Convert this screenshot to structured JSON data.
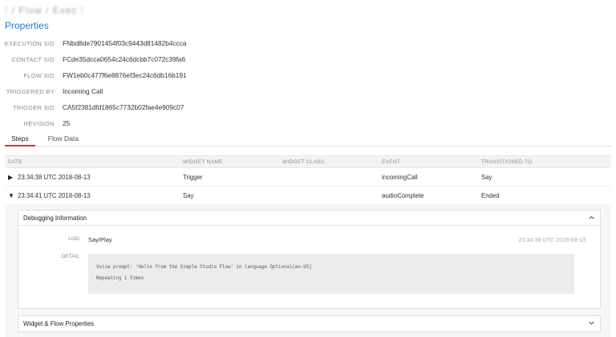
{
  "breadcrumb": {
    "text": "⁞ / Flow / Exec ⁞"
  },
  "page_title": "Properties",
  "properties": [
    {
      "label": "EXECUTION SID",
      "value": "FNbd8de7901454f03c9443d81482b4ccca"
    },
    {
      "label": "CONTACT SID",
      "value": "FCde35dcca0654c24c6dcbb7c072c39fa6"
    },
    {
      "label": "FLOW SID",
      "value": "FW1eb0c477f6e8876ef3ec24c6db16b191"
    },
    {
      "label": "TRIGGERED BY",
      "value": "Incoming Call"
    },
    {
      "label": "TRIGGER SID",
      "value": "CA5f2381dfd1865c7732b02fae4e909c07"
    },
    {
      "label": "REVISION",
      "value": "25"
    }
  ],
  "tabs": [
    {
      "label": "Steps",
      "active": true
    },
    {
      "label": "Flow Data",
      "active": false
    }
  ],
  "table": {
    "headers": [
      "DATE",
      "WIDGET NAME",
      "WIDGET CLASS",
      "EVENT",
      "TRANSITIONED TO"
    ],
    "rows": [
      {
        "toggle": "▶",
        "date": "23:34:38 UTC 2018-08-13",
        "widget_name": "Trigger",
        "widget_class": "",
        "event": "incomingCall",
        "transitioned_to": "Say"
      },
      {
        "toggle": "▼",
        "date": "23:34:41 UTC 2018-08-13",
        "widget_name": "Say",
        "widget_class": "",
        "event": "audioComplete",
        "transitioned_to": "Ended"
      }
    ]
  },
  "debug": {
    "title": "Debugging Information",
    "collapse_icon": "chevron-up-icon",
    "log_label": "LOG",
    "log_value": "Say/Play",
    "log_time": "23:34:38 UTC 2018-08-13",
    "detail_label": "DETAIL",
    "detail_text": "Voice prompt: 'Hello from the Simple Studio Flow' in language Optional[en-US]\nRepeating 1 times"
  },
  "widget_flow": {
    "title": "Widget & Flow Properties",
    "expand_icon": "chevron-down-icon"
  }
}
